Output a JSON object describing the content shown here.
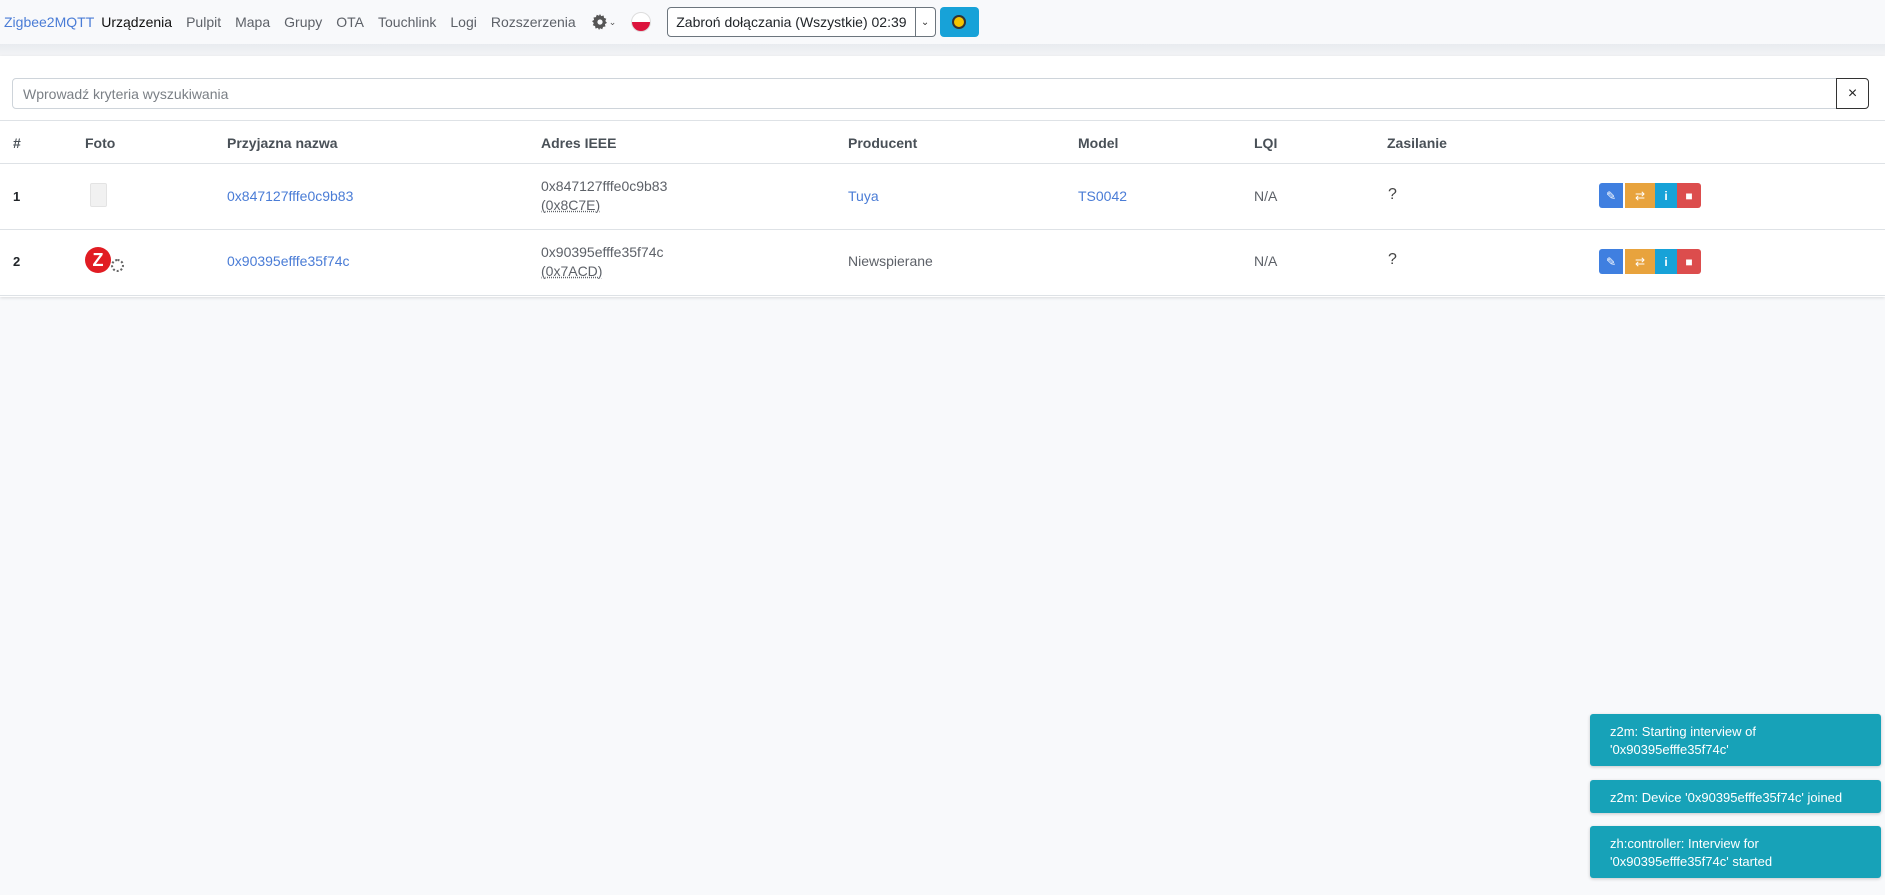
{
  "navbar": {
    "brand": "Zigbee2MQTT",
    "items": [
      "Urządzenia",
      "Pulpit",
      "Mapa",
      "Grupy",
      "OTA",
      "Touchlink",
      "Logi",
      "Rozszerzenia"
    ],
    "settings_icon": "gear-icon",
    "language_flag": "poland-flag-icon",
    "permit_join_label": "Zabroń dołączania (Wszystkie) 02:39",
    "theme_icon": "sun-icon"
  },
  "search": {
    "placeholder": "Wprowadź kryteria wyszukiwania",
    "value": "",
    "clear_label": "×"
  },
  "table": {
    "headers": [
      "#",
      "Foto",
      "Przyjazna nazwa",
      "Adres IEEE",
      "Producent",
      "Model",
      "LQI",
      "Zasilanie"
    ],
    "rows": [
      {
        "index": "1",
        "friendly_name": "0x847127fffe0c9b83",
        "ieee": "0x847127fffe0c9b83",
        "nwk": "(0x8C7E)",
        "vendor": "Tuya",
        "model": "TS0042",
        "lqi": "N/A",
        "power": "?"
      },
      {
        "index": "2",
        "friendly_name": "0x90395efffe35f74c",
        "ieee": "0x90395efffe35f74c",
        "nwk": "(0x7ACD)",
        "vendor": "Niewspierane",
        "model": "",
        "lqi": "N/A",
        "power": "?"
      }
    ]
  },
  "toasts": [
    "z2m: Starting interview of '0x90395efffe35f74c'",
    "z2m: Device '0x90395efffe35f74c' joined",
    "zh:controller: Interview for '0x90395efffe35f74c' started"
  ],
  "colors": {
    "link": "#4a7cd6",
    "toast": "#17a2b8",
    "edit": "#3f7fe0",
    "rename": "#e8a33d",
    "info": "#17a2d8",
    "delete": "#dc4d4d"
  }
}
